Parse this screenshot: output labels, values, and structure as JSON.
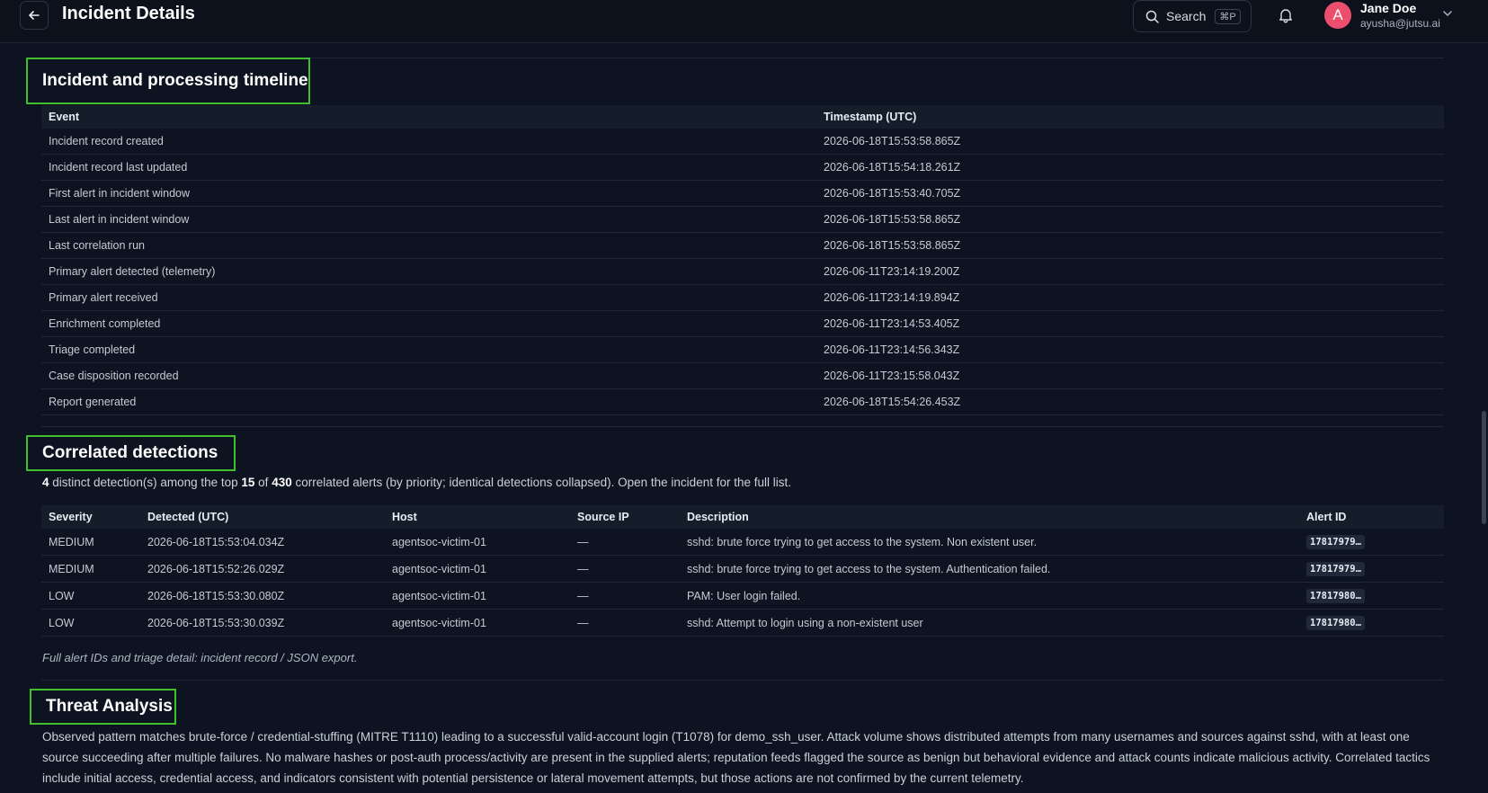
{
  "header": {
    "title": "Incident Details",
    "search_label": "Search",
    "search_shortcut": "⌘P",
    "user": {
      "avatar_initial": "A",
      "name": "Jane Doe",
      "email": "ayusha@jutsu.ai"
    }
  },
  "timeline": {
    "title": "Incident and processing timeline",
    "columns": [
      "Event",
      "Timestamp (UTC)"
    ],
    "rows": [
      {
        "event": "Incident record created",
        "ts": "2026-06-18T15:53:58.865Z"
      },
      {
        "event": "Incident record last updated",
        "ts": "2026-06-18T15:54:18.261Z"
      },
      {
        "event": "First alert in incident window",
        "ts": "2026-06-18T15:53:40.705Z"
      },
      {
        "event": "Last alert in incident window",
        "ts": "2026-06-18T15:53:58.865Z"
      },
      {
        "event": "Last correlation run",
        "ts": "2026-06-18T15:53:58.865Z"
      },
      {
        "event": "Primary alert detected (telemetry)",
        "ts": "2026-06-11T23:14:19.200Z"
      },
      {
        "event": "Primary alert received",
        "ts": "2026-06-11T23:14:19.894Z"
      },
      {
        "event": "Enrichment completed",
        "ts": "2026-06-11T23:14:53.405Z"
      },
      {
        "event": "Triage completed",
        "ts": "2026-06-11T23:14:56.343Z"
      },
      {
        "event": "Case disposition recorded",
        "ts": "2026-06-11T23:15:58.043Z"
      },
      {
        "event": "Report generated",
        "ts": "2026-06-18T15:54:26.453Z"
      }
    ]
  },
  "correlated": {
    "title": "Correlated detections",
    "summary": {
      "distinct": "4",
      "text1": " distinct detection(s) among the top ",
      "top": "15",
      "text2": " of ",
      "total": "430",
      "text3": " correlated alerts (by priority; identical detections collapsed). Open the incident for the full list."
    },
    "columns": [
      "Severity",
      "Detected (UTC)",
      "Host",
      "Source IP",
      "Description",
      "Alert ID"
    ],
    "rows": [
      {
        "severity": "MEDIUM",
        "detected": "2026-06-18T15:53:04.034Z",
        "host": "agentsoc-victim-01",
        "source_ip": "—",
        "description": "sshd: brute force trying to get access to the system. Non existent user.",
        "alert_id": "17817979…"
      },
      {
        "severity": "MEDIUM",
        "detected": "2026-06-18T15:52:26.029Z",
        "host": "agentsoc-victim-01",
        "source_ip": "—",
        "description": "sshd: brute force trying to get access to the system. Authentication failed.",
        "alert_id": "17817979…"
      },
      {
        "severity": "LOW",
        "detected": "2026-06-18T15:53:30.080Z",
        "host": "agentsoc-victim-01",
        "source_ip": "—",
        "description": "PAM: User login failed.",
        "alert_id": "17817980…"
      },
      {
        "severity": "LOW",
        "detected": "2026-06-18T15:53:30.039Z",
        "host": "agentsoc-victim-01",
        "source_ip": "—",
        "description": "sshd: Attempt to login using a non-existent user",
        "alert_id": "17817980…"
      }
    ],
    "footnote": "Full alert IDs and triage detail: incident record / JSON export."
  },
  "threat": {
    "title": "Threat Analysis",
    "text": "Observed pattern matches brute-force / credential-stuffing (MITRE T1110) leading to a successful valid-account login (T1078) for demo_ssh_user. Attack volume shows distributed attempts from many usernames and sources against sshd, with at least one source succeeding after multiple failures. No malware hashes or post-auth process/activity are present in the supplied alerts; reputation feeds flagged the source as benign but behavioral evidence and attack counts indicate malicious activity. Correlated tactics include initial access, credential access, and indicators consistent with potential persistence or lateral movement attempts, but those actions are not confirmed by the current telemetry."
  },
  "colors": {
    "background": "#0d1320",
    "highlight_border": "#3fbf2c",
    "avatar": "#ec4e6e"
  }
}
